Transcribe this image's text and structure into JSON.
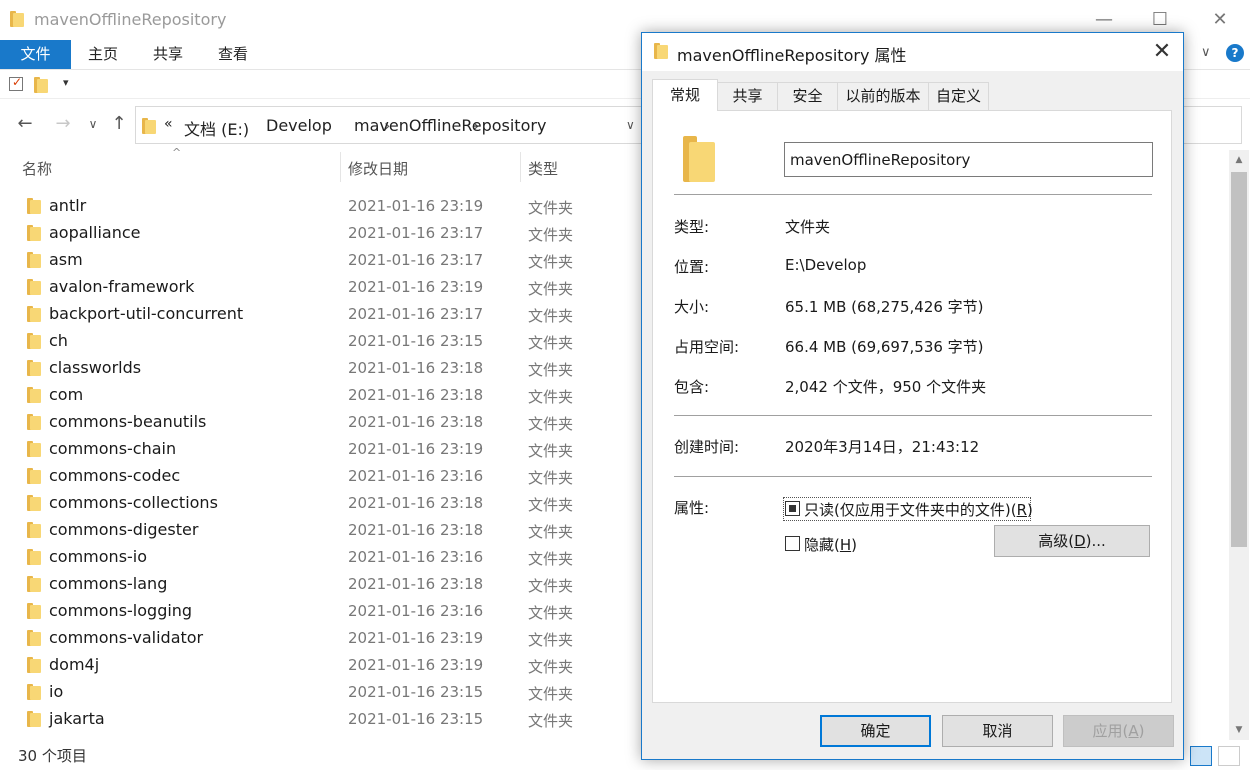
{
  "window": {
    "title": "mavenOfflineRepository",
    "controls": {
      "minimize": "—",
      "maximize": "☐",
      "close": "✕"
    }
  },
  "ribbon": {
    "tabs": [
      "文件",
      "主页",
      "共享",
      "查看"
    ],
    "active_tab": "文件"
  },
  "address": {
    "prefix": "«",
    "segments": [
      "文档 (E:)",
      "Develop",
      "mavenOfflineRepository"
    ],
    "separator": "›"
  },
  "columns": {
    "name": "名称",
    "date": "修改日期",
    "type": "类型"
  },
  "files": [
    {
      "name": "antlr",
      "date": "2021-01-16 23:19",
      "type": "文件夹"
    },
    {
      "name": "aopalliance",
      "date": "2021-01-16 23:17",
      "type": "文件夹"
    },
    {
      "name": "asm",
      "date": "2021-01-16 23:17",
      "type": "文件夹"
    },
    {
      "name": "avalon-framework",
      "date": "2021-01-16 23:19",
      "type": "文件夹"
    },
    {
      "name": "backport-util-concurrent",
      "date": "2021-01-16 23:17",
      "type": "文件夹"
    },
    {
      "name": "ch",
      "date": "2021-01-16 23:15",
      "type": "文件夹"
    },
    {
      "name": "classworlds",
      "date": "2021-01-16 23:18",
      "type": "文件夹"
    },
    {
      "name": "com",
      "date": "2021-01-16 23:18",
      "type": "文件夹"
    },
    {
      "name": "commons-beanutils",
      "date": "2021-01-16 23:18",
      "type": "文件夹"
    },
    {
      "name": "commons-chain",
      "date": "2021-01-16 23:19",
      "type": "文件夹"
    },
    {
      "name": "commons-codec",
      "date": "2021-01-16 23:16",
      "type": "文件夹"
    },
    {
      "name": "commons-collections",
      "date": "2021-01-16 23:18",
      "type": "文件夹"
    },
    {
      "name": "commons-digester",
      "date": "2021-01-16 23:18",
      "type": "文件夹"
    },
    {
      "name": "commons-io",
      "date": "2021-01-16 23:16",
      "type": "文件夹"
    },
    {
      "name": "commons-lang",
      "date": "2021-01-16 23:18",
      "type": "文件夹"
    },
    {
      "name": "commons-logging",
      "date": "2021-01-16 23:16",
      "type": "文件夹"
    },
    {
      "name": "commons-validator",
      "date": "2021-01-16 23:19",
      "type": "文件夹"
    },
    {
      "name": "dom4j",
      "date": "2021-01-16 23:19",
      "type": "文件夹"
    },
    {
      "name": "io",
      "date": "2021-01-16 23:15",
      "type": "文件夹"
    },
    {
      "name": "jakarta",
      "date": "2021-01-16 23:15",
      "type": "文件夹"
    }
  ],
  "status": {
    "item_count": "30 个项目"
  },
  "dialog": {
    "title": "mavenOfflineRepository 属性",
    "tabs": [
      "常规",
      "共享",
      "安全",
      "以前的版本",
      "自定义"
    ],
    "active_tab": "常规",
    "folder_name": "mavenOfflineRepository",
    "props": {
      "type_label": "类型:",
      "type_value": "文件夹",
      "location_label": "位置:",
      "location_value": "E:\\Develop",
      "size_label": "大小:",
      "size_value": "65.1 MB (68,275,426 字节)",
      "disk_label": "占用空间:",
      "disk_value": "66.4 MB (69,697,536 字节)",
      "contains_label": "包含:",
      "contains_value": "2,042 个文件，950 个文件夹",
      "created_label": "创建时间:",
      "created_value": "2020年3月14日，21:43:12",
      "attr_label": "属性:"
    },
    "readonly": {
      "text": "只读(仅应用于文件夹中的文件)(",
      "key": "R",
      "end": ")",
      "state": "indeterminate"
    },
    "hidden": {
      "text": "隐藏(",
      "key": "H",
      "end": ")",
      "checked": false
    },
    "advanced": {
      "text": "高级(",
      "key": "D",
      "end": ")..."
    },
    "buttons": {
      "ok": "确定",
      "cancel": "取消",
      "apply_text": "应用(",
      "apply_key": "A",
      "apply_end": ")"
    }
  },
  "colors": {
    "accent": "#1979ca",
    "folder": "#f8d775"
  }
}
